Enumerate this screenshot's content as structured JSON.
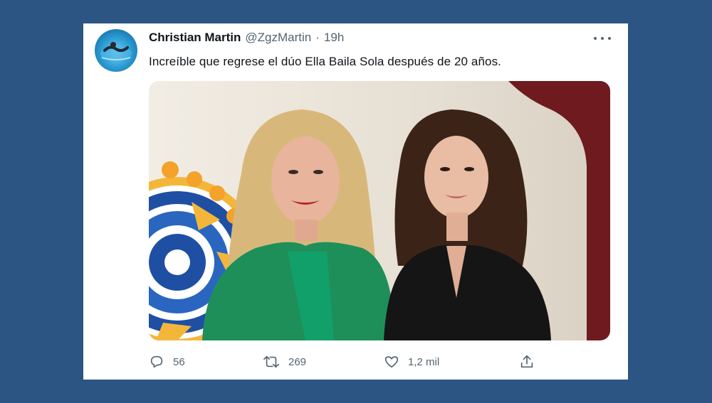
{
  "tweet": {
    "author_name": "Christian Martin",
    "handle": "@ZgzMartin",
    "separator": "·",
    "time": "19h",
    "text": "Increíble que regrese el dúo Ella Baila Sola después de 20 años.",
    "more_icon": "more-icon"
  },
  "media": {
    "type": "photo",
    "description_icon": "photo"
  },
  "actions": {
    "replies": "56",
    "retweets": "269",
    "likes": "1,2 mil",
    "icons": [
      "reply-icon",
      "retweet-icon",
      "like-icon",
      "share-icon"
    ]
  },
  "colors": {
    "background": "#2c5583",
    "card": "#ffffff",
    "text": "#0f1419",
    "secondary_text": "#536471"
  }
}
